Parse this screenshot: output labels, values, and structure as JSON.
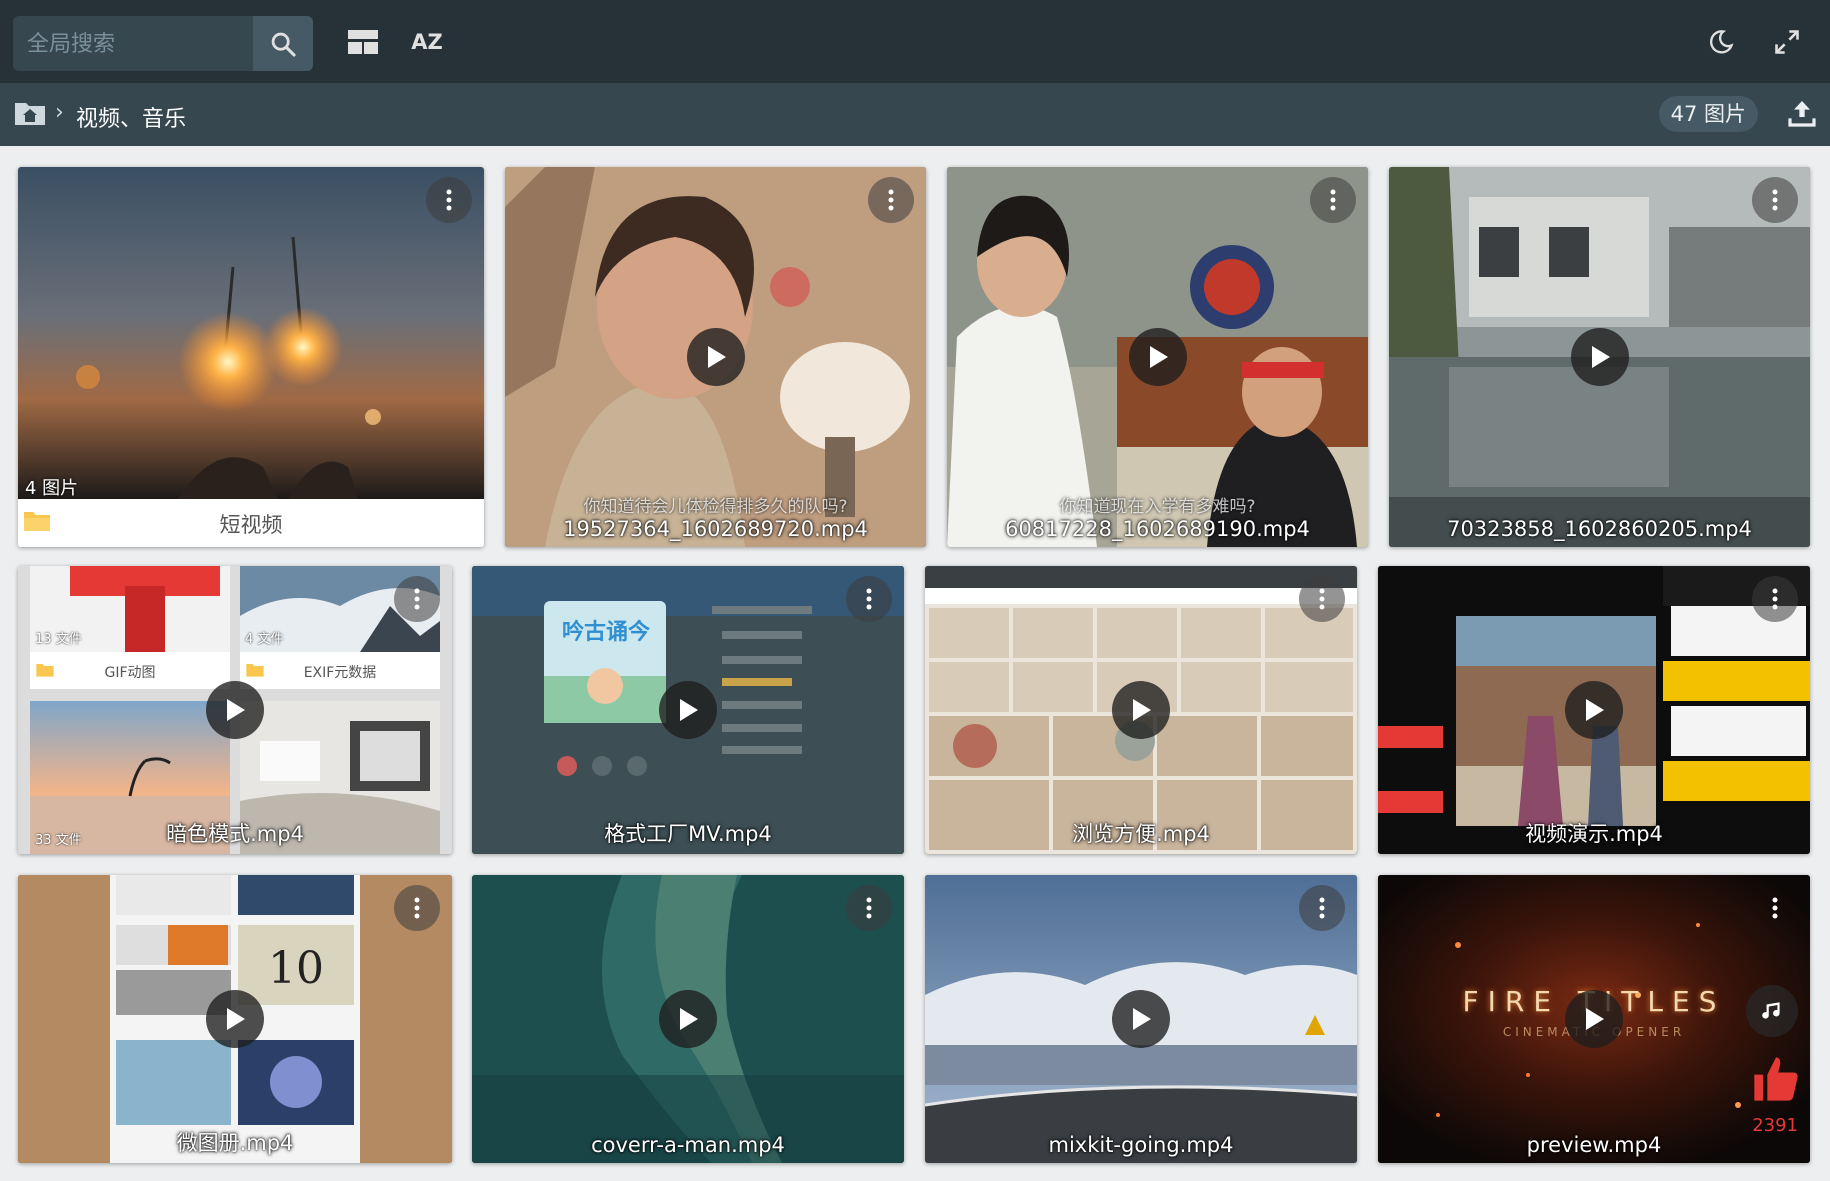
{
  "search": {
    "placeholder": "全局搜索"
  },
  "toolbar": {
    "sort_label": "AZ"
  },
  "breadcrumb": {
    "separator": "›",
    "current": "视频、音乐"
  },
  "counter": {
    "label": "47 图片"
  },
  "colors": {
    "topbar": "#263238",
    "breadcrumb_bar": "#37474f",
    "background": "#eceeef",
    "like": "#e53935"
  },
  "folder_card": {
    "name": "短视频",
    "count": "4 图片"
  },
  "videos_row1": [
    {
      "name": "19527364_1602689720.mp4",
      "caption": "你知道待会儿体检得排多久的队吗?"
    },
    {
      "name": "60817228_1602689190.mp4",
      "caption": "你知道现在入学有多难吗?"
    },
    {
      "name": "70323858_1602860205.mp4"
    }
  ],
  "videos_row2": [
    {
      "name": "暗色模式.mp4",
      "mini_folders": [
        {
          "count": "13 文件",
          "name": "GIF动图"
        },
        {
          "count": "4 文件",
          "name": "EXIF元数据"
        },
        {
          "count": "33 文件"
        }
      ]
    },
    {
      "name": "格式工厂MV.mp4",
      "album_title": "吟古诵今"
    },
    {
      "name": "浏览方便.mp4"
    },
    {
      "name": "视频演示.mp4"
    }
  ],
  "videos_row3": [
    {
      "name": "微图册.mp4",
      "poster_number": "10"
    },
    {
      "name": "coverr-a-man.mp4"
    },
    {
      "name": "mixkit-going.mp4"
    },
    {
      "name": "preview.mp4",
      "title_text": "FIRE TITLES",
      "subtitle_text": "CINEMATIC OPENER",
      "likes": "2391"
    }
  ],
  "icons": [
    "search-icon",
    "layout-icon",
    "sort-az-icon",
    "moon-icon",
    "fullscreen-icon",
    "home-folder-icon",
    "upload-icon",
    "more-vert-icon",
    "play-icon",
    "folder-icon",
    "music-note-icon",
    "thumb-up-icon"
  ]
}
